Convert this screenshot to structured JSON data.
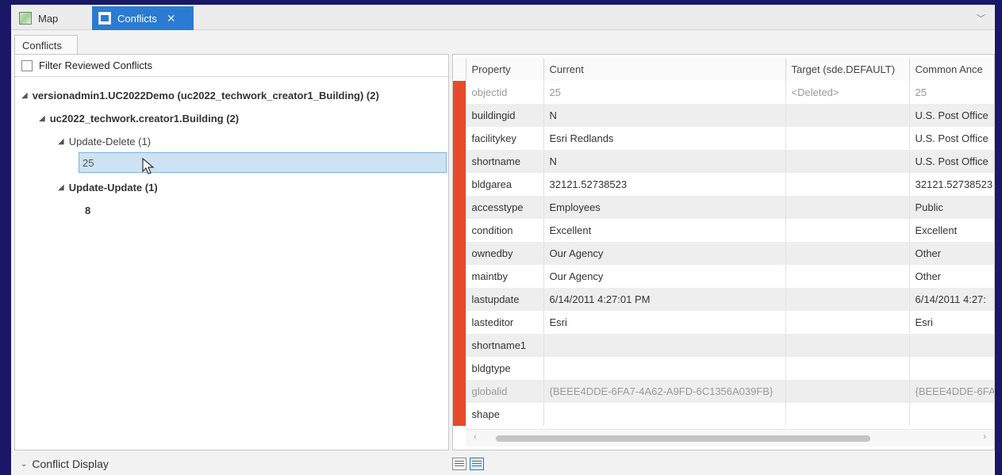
{
  "tabs": [
    {
      "label": "Map",
      "icon": "map-icon"
    },
    {
      "label": "Conflicts",
      "icon": "conflicts-icon",
      "active": true
    }
  ],
  "subtab": {
    "label": "Conflicts"
  },
  "filter": {
    "label": "Filter Reviewed Conflicts",
    "checked": false
  },
  "tree": {
    "root": "versionadmin1.UC2022Demo (uc2022_techwork_creator1_Building) (2)",
    "layer": "uc2022_techwork.creator1.Building (2)",
    "group1": "Update-Delete (1)",
    "group1_item": "25",
    "group2": "Update-Update (1)",
    "group2_item": "8"
  },
  "grid": {
    "headers": [
      "Property",
      "Current",
      "Target (sde.DEFAULT)",
      "Common Ance"
    ],
    "rows": [
      {
        "property": "objectid",
        "current": "25",
        "target": "<Deleted>",
        "common": "25"
      },
      {
        "property": "buildingid",
        "current": "N",
        "target": "",
        "common": "U.S. Post Office"
      },
      {
        "property": "facilitykey",
        "current": "Esri Redlands",
        "target": "",
        "common": "U.S. Post Office"
      },
      {
        "property": "shortname",
        "current": "N",
        "target": "",
        "common": "U.S. Post Office"
      },
      {
        "property": "bldgarea",
        "current": "32121.52738523",
        "target": "",
        "common": "32121.52738523"
      },
      {
        "property": "accesstype",
        "current": "Employees",
        "target": "",
        "common": "Public"
      },
      {
        "property": "condition",
        "current": "Excellent",
        "target": "",
        "common": "Excellent"
      },
      {
        "property": "ownedby",
        "current": "Our Agency",
        "target": "",
        "common": "Other"
      },
      {
        "property": "maintby",
        "current": "Our Agency",
        "target": "",
        "common": "Other"
      },
      {
        "property": "lastupdate",
        "current": "6/14/2011 4:27:01 PM",
        "target": "",
        "common": "6/14/2011 4:27:"
      },
      {
        "property": "lasteditor",
        "current": "Esri",
        "target": "",
        "common": "Esri"
      },
      {
        "property": "shortname1",
        "current": "",
        "target": "",
        "common": ""
      },
      {
        "property": "bldgtype",
        "current": "",
        "target": "",
        "common": ""
      },
      {
        "property": "globalid",
        "current": "{BEEE4DDE-6FA7-4A62-A9FD-6C1356A039FB}",
        "target": "",
        "common": "{BEEE4DDE-6FA"
      },
      {
        "property": "shape",
        "current": "",
        "target": "",
        "common": ""
      }
    ]
  },
  "bottom": {
    "conflict_display": "Conflict Display"
  },
  "colors": {
    "accent": "#2a7bd1",
    "conflict_marker": "#e54b2a",
    "selection": "#cde3f3"
  }
}
